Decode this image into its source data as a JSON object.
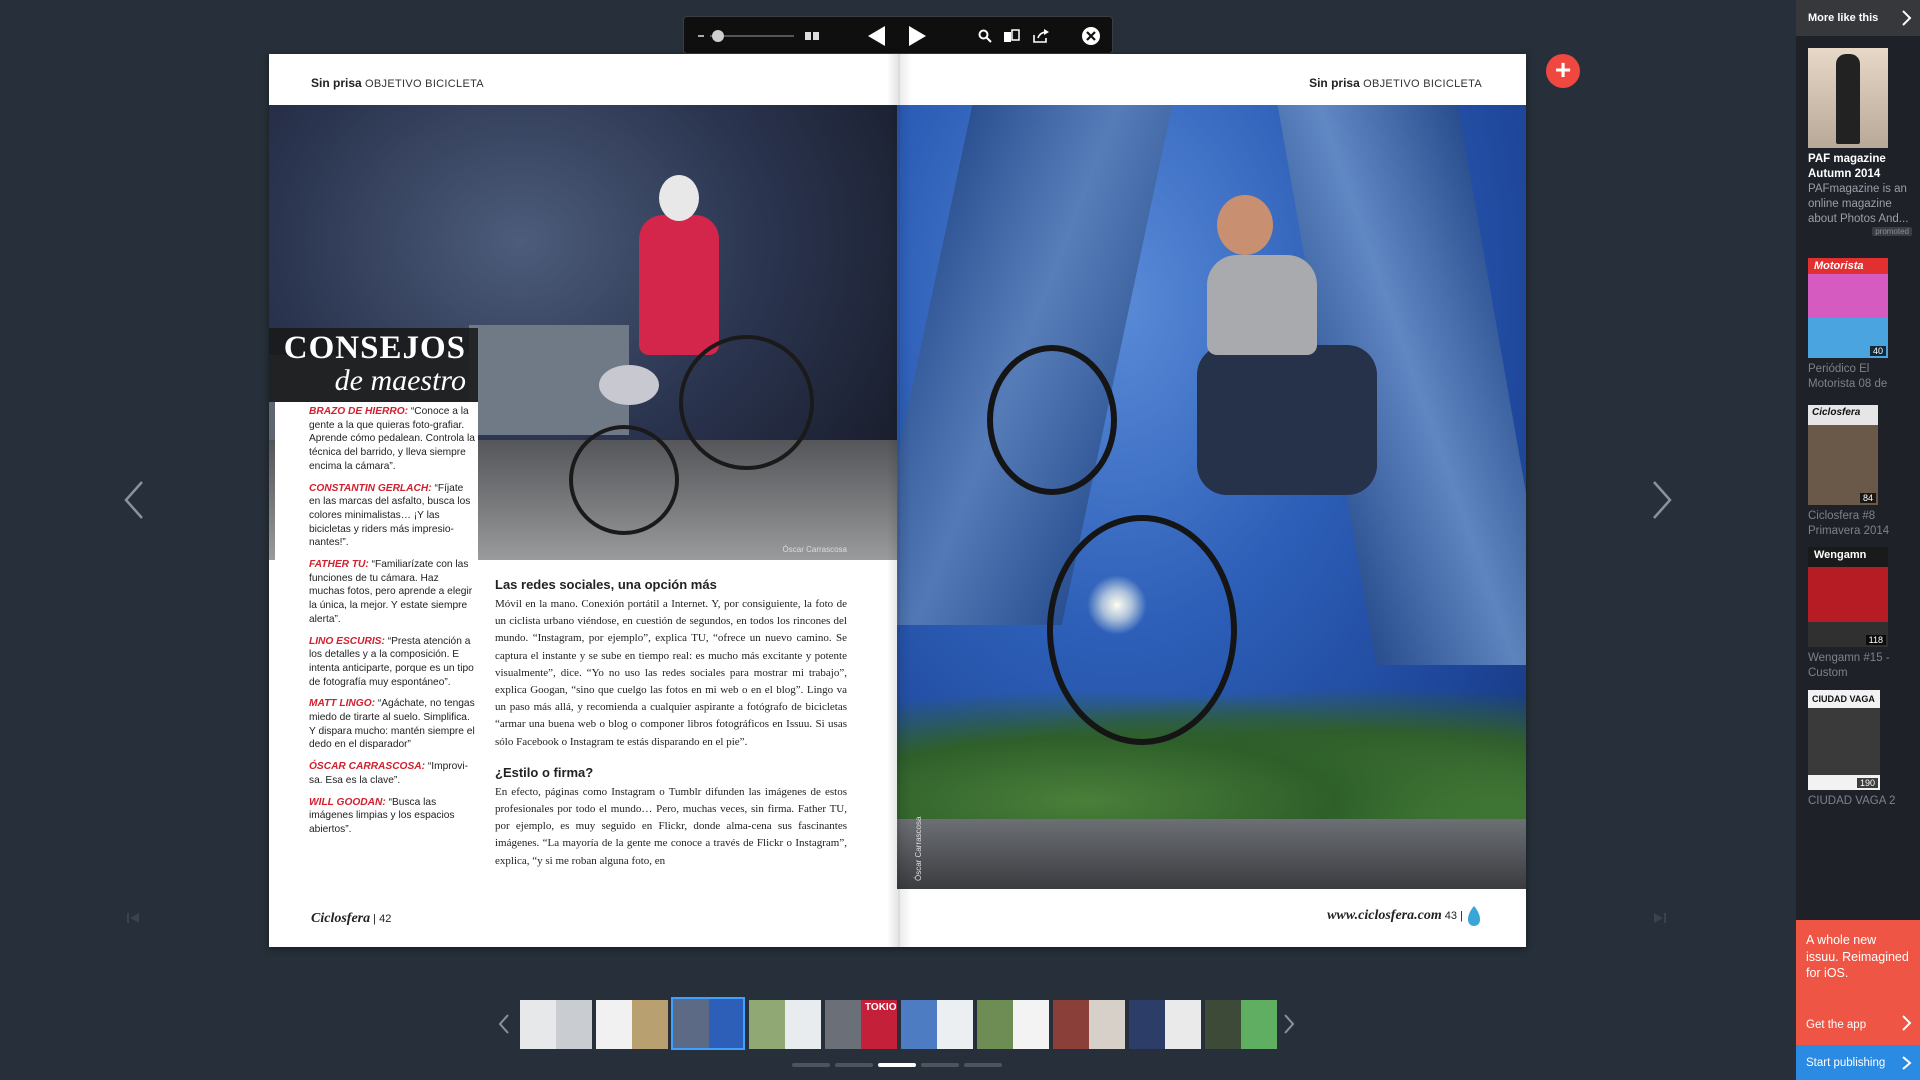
{
  "toolbar": {
    "zoom_level": 0.05,
    "icons": [
      "zoom-slider",
      "spread-view-icon",
      "prev-triangle-icon",
      "next-triangle-icon",
      "search-icon",
      "thumbnails-icon",
      "share-icon",
      "close-icon"
    ]
  },
  "spread": {
    "left_header_section": "Sin prisa",
    "left_header_sub": "OBJETIVO BICICLETA",
    "right_header_section": "Sin prisa",
    "right_header_sub": "OBJETIVO BICICLETA",
    "consejos_title": "CONSEJOS",
    "consejos_subtitle": "de maestro",
    "tips": [
      {
        "name": "BRAZO DE HIERRO:",
        "text": " “Conoce a la gente a la que quieras foto-grafiar. Aprende cómo pedalean. Controla la técnica del barrido, y lleva siempre encima la cámara”."
      },
      {
        "name": "CONSTANTIN GERLACH:",
        "text": " “Fíjate en las marcas del asfalto, busca los colores minimalistas… ¡Y las bicicletas y riders más impresio-nantes!”."
      },
      {
        "name": "FATHER TU:",
        "text": " “Familiarízate con las funciones de tu cámara. Haz muchas fotos, pero aprende a elegir la única, la mejor. Y estate siempre alerta”."
      },
      {
        "name": "LINO ESCURIS:",
        "text": " “Presta atención a los detalles y a la composición. E intenta anticiparte, porque es un tipo de fotografía muy espontáneo”."
      },
      {
        "name": "MATT LINGO:",
        "text": " “Agáchate, no tengas miedo de tirarte al suelo. Simplifica. Y dispara mucho: mantén siempre el dedo en el disparador”"
      },
      {
        "name": "ÓSCAR CARRASCOSA:",
        "text": " “Improvi-sa. Esa es la clave”."
      },
      {
        "name": "WILL GOODAN:",
        "text": " “Busca las imágenes limpias y los espacios abiertos”."
      }
    ],
    "photo_credit_left": "Óscar Carrascosa",
    "photo_credit_right": "Óscar Carrascosa",
    "article_heading_1": "Las redes sociales, una opción más",
    "article_body_1": "Móvil en la mano. Conexión portátil a Internet. Y, por consiguiente, la foto de un ciclista urbano viéndose, en cuestión de segundos, en todos los rincones del mundo. “Instagram, por ejemplo”, explica TU, “ofrece un nuevo camino. Se captura el instante y se sube en tiempo real: es mucho más excitante y potente visualmente”, dice. “Yo no uso las redes sociales para mostrar mi trabajo”, explica Googan, “sino que cuelgo las fotos en mi web o en el blog”. Lingo va un paso más allá, y recomienda a cualquier aspirante a fotógrafo de bicicletas “armar una buena web o blog o componer libros fotográficos en Issuu. Si usas sólo Facebook o Instagram te estás disparando en el pie”.",
    "article_heading_2": "¿Estilo o firma?",
    "article_body_2": "En efecto, páginas como Instagram o Tumblr difunden las imágenes de estos profesionales por todo el mundo… Pero, muchas veces, sin firma. Father TU, por ejemplo, es muy seguido en Flickr, donde alma-cena sus fascinantes imágenes. “La mayoría de la gente me conoce a través de Flickr o Instagram”, explica, “y si me roban alguna foto, en",
    "left_footer_brand": "Ciclosfera",
    "left_footer_page": "| 42",
    "right_footer_url": "www.ciclosfera.com",
    "right_footer_page": "43 |"
  },
  "nav": {
    "plus_label": "+",
    "prev_arrow": "‹",
    "next_arrow": "›"
  },
  "thumbs": {
    "count": 10,
    "active_index": 2,
    "overlay_text": "TOKIO",
    "dots_count": 5,
    "dots_active": 2
  },
  "sidebar": {
    "more_label": "More like this",
    "items": [
      {
        "title": "PAF magazine Autumn 2014",
        "desc": "PAFmagazine is an online magazine about Photos And...",
        "badge": "promoted",
        "count": ""
      },
      {
        "title": "Periódico El Motorista 08 de",
        "desc": "",
        "badge": "",
        "count": "40"
      },
      {
        "title": "Ciclosfera #8 Primavera 2014",
        "desc": "",
        "badge": "",
        "count": "84"
      },
      {
        "title": "Wengamn #15 - Custom",
        "desc": "",
        "badge": "",
        "count": "118"
      },
      {
        "title": "CIUDAD VAGA 2",
        "desc": "",
        "badge": "",
        "count": "190"
      }
    ],
    "cover_labels": [
      "",
      "Motorista",
      "Ciclosfera",
      "Wengamn",
      "CIUDAD VAGA"
    ],
    "promo_text": "A whole new issuu. Reimagined for iOS.",
    "promo_cta": "Get the app",
    "publish_label": "Start publishing"
  },
  "colors": {
    "background": "#27303a",
    "accent_red": "#d1202e",
    "promo": "#ef5544",
    "publish": "#2b8ae2",
    "active_thumb": "#3da2ff"
  }
}
